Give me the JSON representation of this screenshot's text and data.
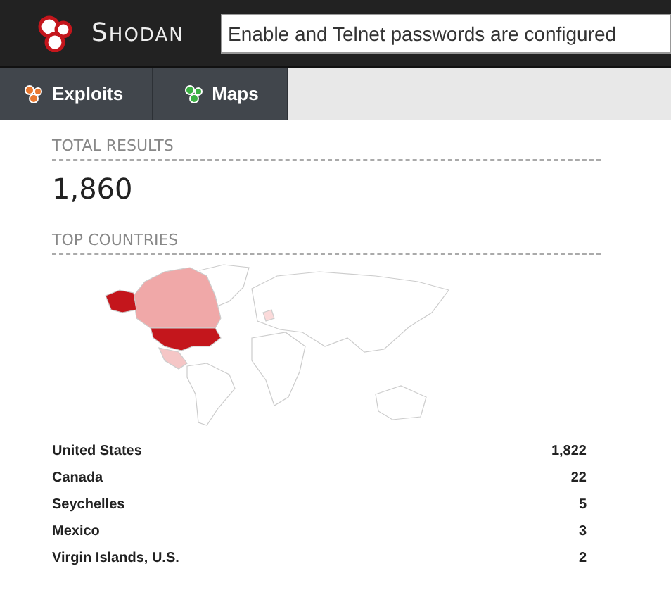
{
  "header": {
    "logo_text": "Shodan"
  },
  "search": {
    "value": "Enable and Telnet passwords are configured"
  },
  "tabs": [
    {
      "label": "Exploits",
      "kind": "exploits"
    },
    {
      "label": "Maps",
      "kind": "maps"
    }
  ],
  "total_results": {
    "heading": "TOTAL RESULTS",
    "value": "1,860"
  },
  "top_countries": {
    "heading": "TOP COUNTRIES",
    "rows": [
      {
        "country": "United States",
        "count": "1,822"
      },
      {
        "country": "Canada",
        "count": "22"
      },
      {
        "country": "Seychelles",
        "count": "5"
      },
      {
        "country": "Mexico",
        "count": "3"
      },
      {
        "country": "Virgin Islands, U.S.",
        "count": "2"
      }
    ]
  }
}
